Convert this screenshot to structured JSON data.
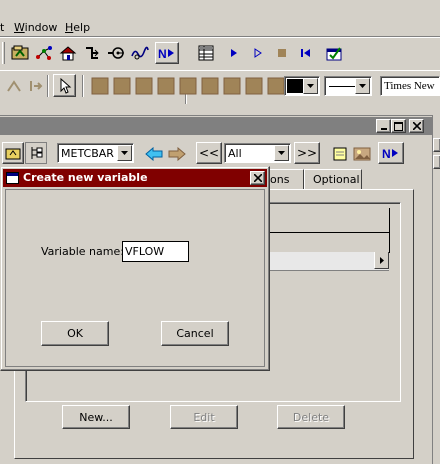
{
  "menu": {
    "items": [
      {
        "label": "t",
        "accel": ""
      },
      {
        "label": "Window",
        "accel": "W"
      },
      {
        "label": "Help",
        "accel": "H"
      }
    ]
  },
  "format_bar": {
    "font_name": "Times New"
  },
  "doc": {
    "variable_set": "METCBAR",
    "filter": "All",
    "nav_prev": "<<",
    "nav_next": ">>",
    "tabs": [
      "ions",
      "Optional"
    ],
    "new_label": "New...",
    "edit_label": "Edit",
    "delete_label": "Delete"
  },
  "dialog": {
    "title": "Create new variable",
    "field_label": "Variable name:",
    "field_value": "VFLOW",
    "ok_label": "OK",
    "cancel_label": "Cancel"
  },
  "colors": {
    "face": "#d4d0c8",
    "dialog_title": "#800000",
    "accent_blue": "#0000c0",
    "swatch_brown": "#a08458"
  }
}
